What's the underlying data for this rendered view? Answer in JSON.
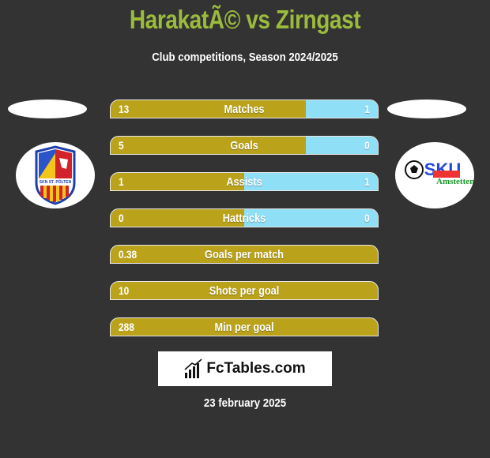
{
  "header": {
    "title": "HarakatÃ© vs Zirngast",
    "subtitle": "Club competitions, Season 2024/2025"
  },
  "teams": {
    "left": {
      "logo": "skn-st-polten-crest",
      "logo_text": "SKN ST. PÖLTEN"
    },
    "right": {
      "logo": "sku-amstetten-crest",
      "logo_text": "SKU Amstetten"
    }
  },
  "colors": {
    "left_bar": "#baa31b",
    "right_bar": "#8fdff7",
    "title": "#9bbb3c",
    "background": "#333333"
  },
  "stats": [
    {
      "label": "Matches",
      "left": "13",
      "right": "1",
      "right_share": 0.27
    },
    {
      "label": "Goals",
      "left": "5",
      "right": "0",
      "right_share": 0.27
    },
    {
      "label": "Assists",
      "left": "1",
      "right": "1",
      "right_share": 0.5
    },
    {
      "label": "Hattricks",
      "left": "0",
      "right": "0",
      "right_share": 0.5
    },
    {
      "label": "Goals per match",
      "left": "0.38",
      "right": "",
      "right_share": 0
    },
    {
      "label": "Shots per goal",
      "left": "10",
      "right": "",
      "right_share": 0
    },
    {
      "label": "Min per goal",
      "left": "288",
      "right": "",
      "right_share": 0
    }
  ],
  "brand": {
    "name": "FcTables.com",
    "icon": "bar-chart-icon"
  },
  "footer": {
    "date": "23 february 2025"
  }
}
